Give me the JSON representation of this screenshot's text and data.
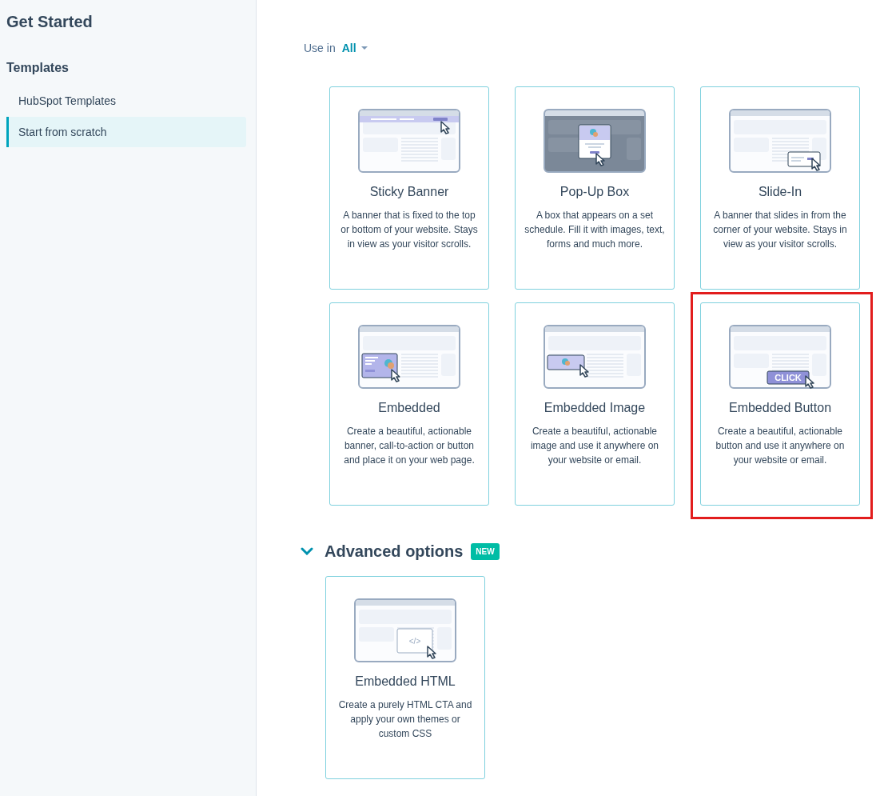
{
  "sidebar": {
    "title": "Get Started",
    "section": "Templates",
    "items": [
      {
        "label": "HubSpot Templates",
        "selected": false
      },
      {
        "label": "Start from scratch",
        "selected": true
      }
    ]
  },
  "filter": {
    "label": "Use in",
    "value": "All"
  },
  "cards": [
    {
      "kind": "sticky",
      "title": "Sticky Banner",
      "description": "A banner that is fixed to the top or bottom of your website. Stays in view as your visitor scrolls.",
      "highlighted": false
    },
    {
      "kind": "popup",
      "title": "Pop-Up Box",
      "description": "A box that appears on a set schedule. Fill it with images, text, forms and much more.",
      "highlighted": false
    },
    {
      "kind": "slidein",
      "title": "Slide-In",
      "description": "A banner that slides in from the corner of your website. Stays in view as your visitor scrolls.",
      "highlighted": false
    },
    {
      "kind": "embedded",
      "title": "Embedded",
      "description": "Create a beautiful, actionable banner, call-to-action or button and place it on your web page.",
      "highlighted": false
    },
    {
      "kind": "image",
      "title": "Embedded Image",
      "description": "Create a beautiful, actionable image and use it anywhere on your website or email.",
      "highlighted": false
    },
    {
      "kind": "button",
      "title": "Embedded Button",
      "description": "Create a beautiful, actionable button and use it anywhere on your website or email.",
      "illustration_label": "CLICK",
      "highlighted": true
    }
  ],
  "advanced": {
    "title": "Advanced options",
    "badge": "NEW",
    "expanded": true,
    "cards": [
      {
        "kind": "html",
        "title": "Embedded HTML",
        "description": "Create a purely HTML CTA and apply your own themes or custom CSS",
        "illustration_label": "</>",
        "highlighted": false
      }
    ]
  }
}
